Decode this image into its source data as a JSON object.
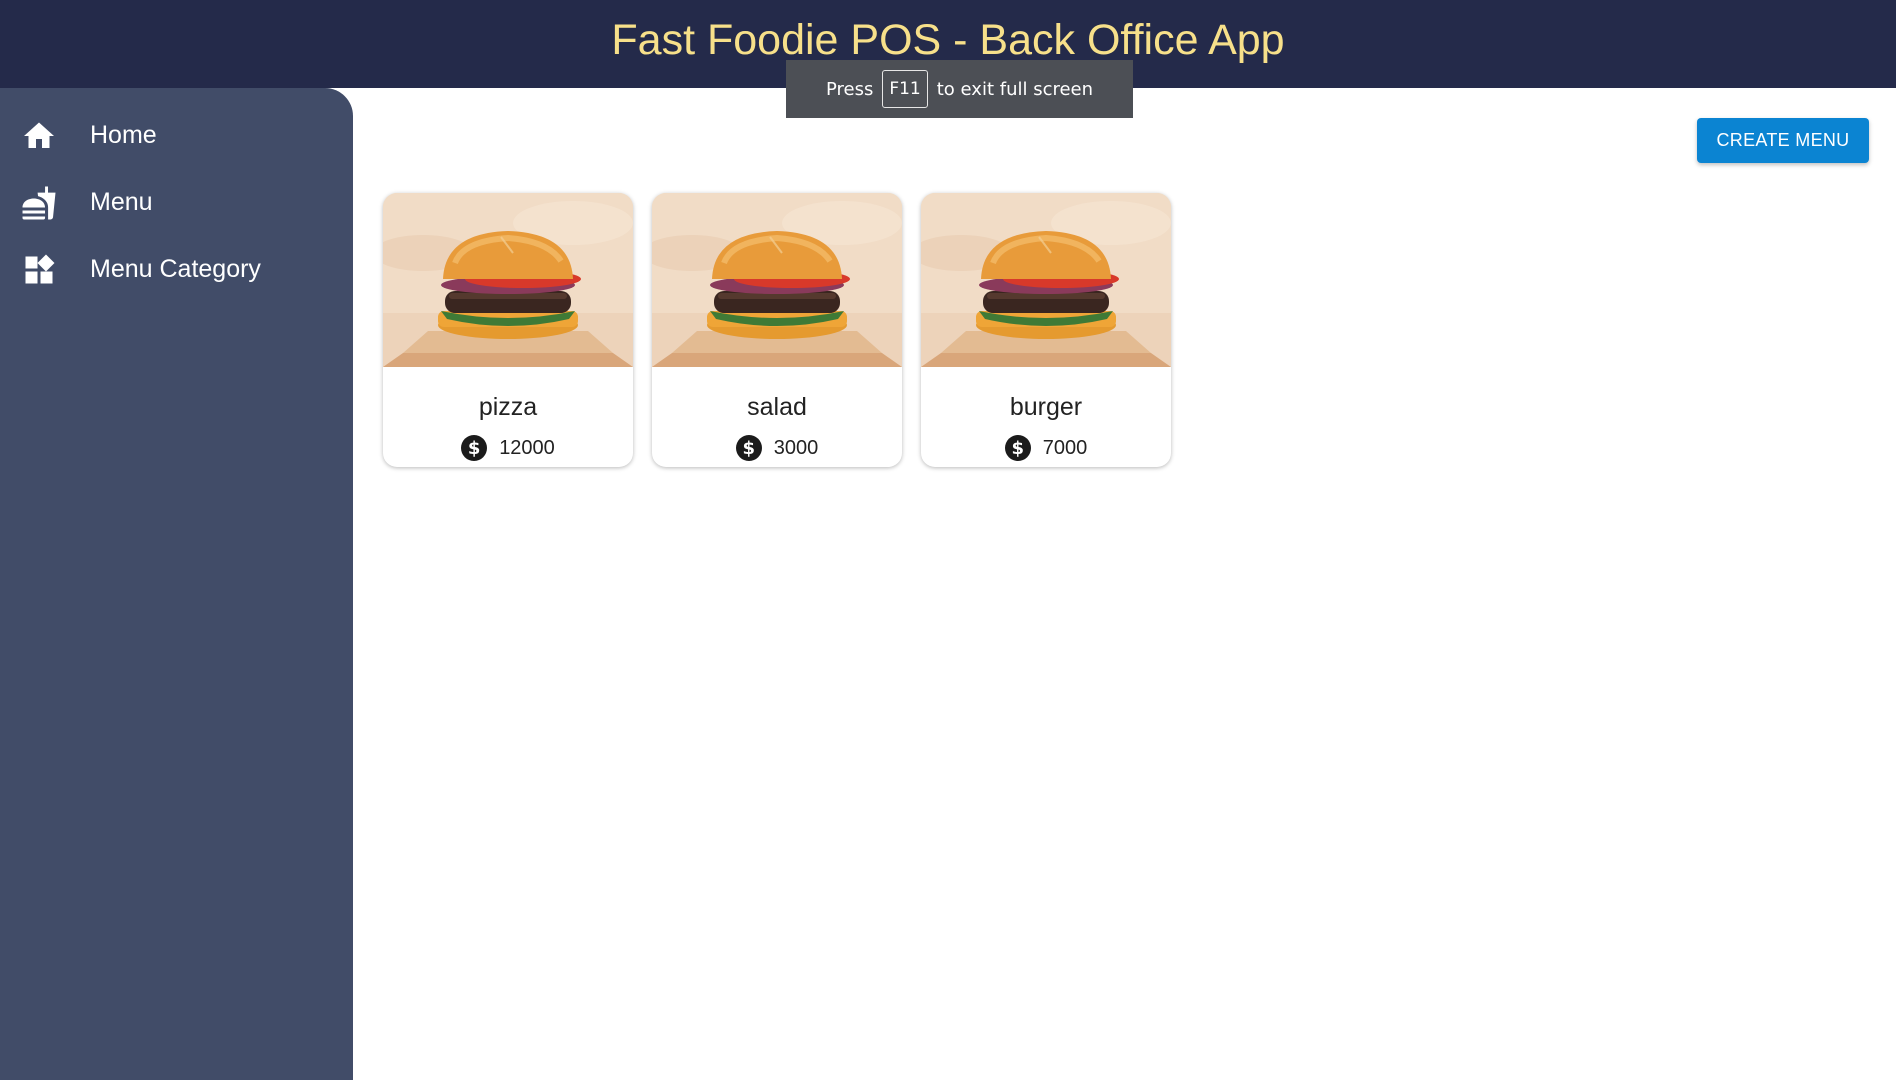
{
  "app": {
    "title": "Fast Foodie POS - Back Office App"
  },
  "sidebar": {
    "items": [
      {
        "label": "Home",
        "icon": "home-icon"
      },
      {
        "label": "Menu",
        "icon": "menu-food-icon"
      },
      {
        "label": "Menu Category",
        "icon": "category-widgets-icon"
      }
    ]
  },
  "fullscreen_notice": {
    "before": "Press",
    "key": "F11",
    "after": "to exit full screen"
  },
  "actions": {
    "create_menu": "CREATE MENU"
  },
  "menus": [
    {
      "name": "pizza",
      "price": "12000",
      "image": "burger-photo",
      "price_icon": "dollar-circle-icon"
    },
    {
      "name": "salad",
      "price": "3000",
      "image": "burger-photo",
      "price_icon": "dollar-circle-icon"
    },
    {
      "name": "burger",
      "price": "7000",
      "image": "burger-photo",
      "price_icon": "dollar-circle-icon"
    }
  ],
  "colors": {
    "topbar": "#242a4a",
    "title": "#f7e08a",
    "sidebar": "#414c68",
    "primary_button": "#0b84d2"
  }
}
